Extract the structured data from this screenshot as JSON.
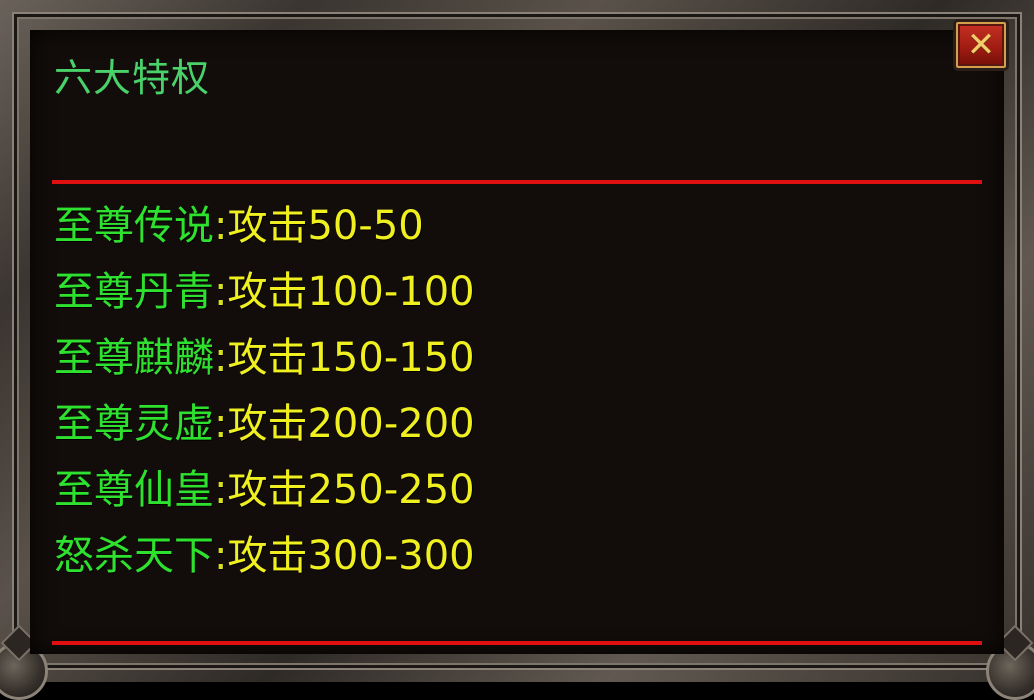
{
  "dialog": {
    "title": "六大特权",
    "close_icon": "close-icon",
    "close_glyph": "✕"
  },
  "colors": {
    "title": "#49d26a",
    "privilege_name": "#2fe12f",
    "privilege_value": "#f0f020",
    "divider": "#e01010",
    "panel_bg": "#120d0a",
    "close_button": "#a21c13"
  },
  "privileges": [
    {
      "name": "至尊传说",
      "separator": ":",
      "value": "攻击50-50"
    },
    {
      "name": "至尊丹青",
      "separator": ":",
      "value": "攻击100-100"
    },
    {
      "name": "至尊麒麟",
      "separator": ":",
      "value": "攻击150-150"
    },
    {
      "name": "至尊灵虚",
      "separator": ":",
      "value": "攻击200-200"
    },
    {
      "name": "至尊仙皇",
      "separator": ":",
      "value": "攻击250-250"
    },
    {
      "name": "怒杀天下",
      "separator": ":",
      "value": "攻击300-300"
    }
  ]
}
